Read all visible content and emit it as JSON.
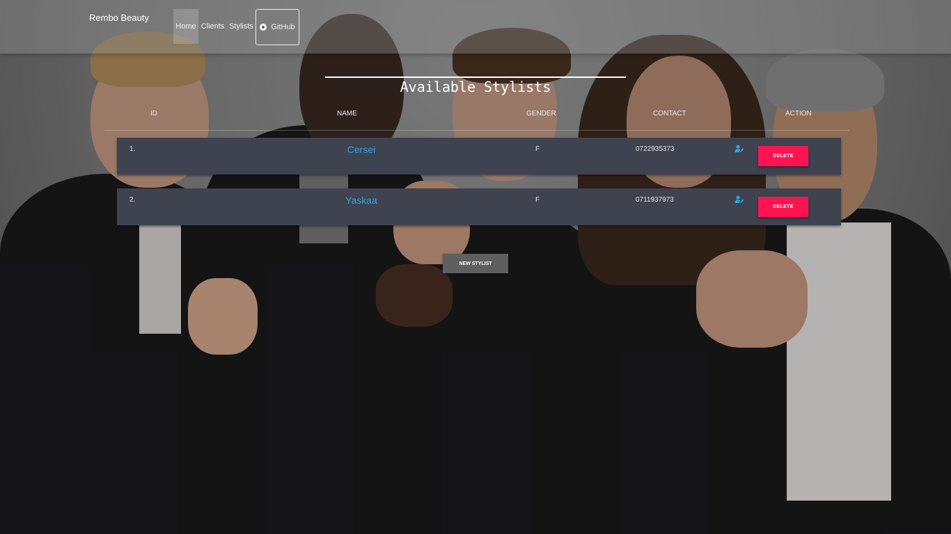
{
  "navbar": {
    "brand": "Rembo Beauty",
    "items": [
      {
        "label": "Home",
        "active": true
      },
      {
        "label": "Clients"
      },
      {
        "label": "Stylists"
      },
      {
        "label": "GitHub",
        "icon": "github-icon"
      }
    ]
  },
  "page": {
    "title": "Available Stylists"
  },
  "table": {
    "headers": [
      "ID",
      "NAME",
      "GENDER",
      "CONTACT",
      "ACTION"
    ],
    "rows": [
      {
        "id": "1.",
        "name": "Cersei",
        "gender": "F",
        "contact": "0722935373",
        "edit_icon": "person-edit-icon",
        "delete_label": "DELETE"
      },
      {
        "id": "2.",
        "name": "Yaskaa",
        "gender": "F",
        "contact": "0711937973",
        "edit_icon": "person-edit-icon",
        "delete_label": "DELETE"
      }
    ]
  },
  "actions": {
    "new_stylist_label": "NEW STYLIST"
  },
  "colors": {
    "row_bg": "#3f4350",
    "name_link": "#2aa6e0",
    "delete_button": "#ff1451",
    "new_button": "#5f5f5f"
  }
}
